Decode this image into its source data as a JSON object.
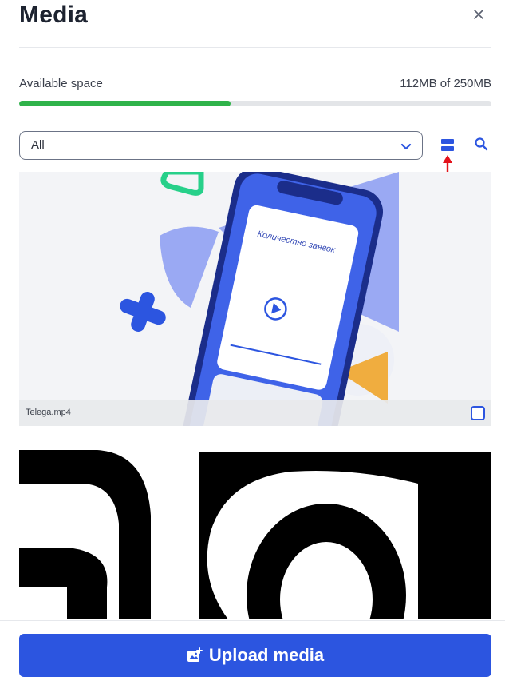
{
  "header": {
    "title": "Media",
    "close_icon": "close-icon"
  },
  "storage": {
    "label": "Available space",
    "value": "112MB of 250MB",
    "used_fraction": 0.448,
    "bar_color": "#2fb34a"
  },
  "filter": {
    "selected": "All",
    "chevron_icon": "chevron-down-icon"
  },
  "toolbar": {
    "view_icon": "list-view-icon",
    "search_icon": "search-icon",
    "accent": "#2c55e0"
  },
  "media": {
    "items": [
      {
        "name": "Telega.mp4",
        "thumb_text": "Количество заявок",
        "checked": false
      },
      {
        "name": "",
        "checked": false
      }
    ]
  },
  "footer": {
    "upload_label": "Upload media",
    "upload_icon": "image-add-icon"
  }
}
